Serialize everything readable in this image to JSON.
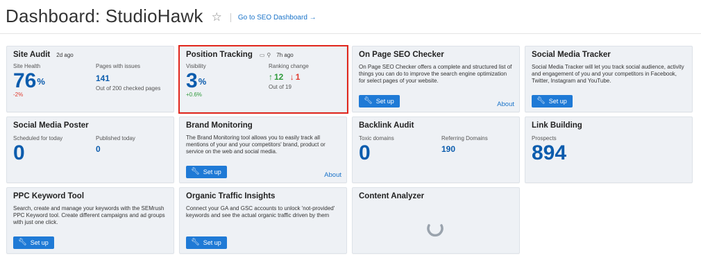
{
  "header": {
    "title": "Dashboard: StudioHawk",
    "seo_link": "Go to SEO Dashboard →"
  },
  "site_audit": {
    "title": "Site Audit",
    "age": "2d ago",
    "health_label": "Site Health",
    "health_value": "76",
    "health_unit": "%",
    "health_change": "-2%",
    "pages_label": "Pages with issues",
    "pages_value": "141",
    "pages_sub": "Out of 200 checked pages"
  },
  "position_tracking": {
    "title": "Position Tracking",
    "age": "7h ago",
    "visibility_label": "Visibility",
    "visibility_value": "3",
    "visibility_unit": "%",
    "visibility_change": "+0.6%",
    "ranking_label": "Ranking change",
    "up_value": "12",
    "down_value": "1",
    "out_of": "Out of 19"
  },
  "on_page": {
    "title": "On Page SEO Checker",
    "desc": "On Page SEO Checker offers a complete and structured list of things you can do to improve the search engine optimization for select pages of your website.",
    "button": "Set up",
    "about": "About"
  },
  "social_tracker": {
    "title": "Social Media Tracker",
    "desc": "Social Media Tracker will let you track social audience, activity and engagement of you and your competitors in Facebook, Twitter, Instagram and YouTube.",
    "button": "Set up"
  },
  "social_poster": {
    "title": "Social Media Poster",
    "scheduled_label": "Scheduled for today",
    "scheduled_value": "0",
    "published_label": "Published today",
    "published_value": "0"
  },
  "brand": {
    "title": "Brand Monitoring",
    "desc": "The Brand Monitoring tool allows you to easily track all mentions of your and your competitors' brand, product or service on the web and social media.",
    "button": "Set up",
    "about": "About"
  },
  "backlink": {
    "title": "Backlink Audit",
    "toxic_label": "Toxic domains",
    "toxic_value": "0",
    "ref_label": "Referring Domains",
    "ref_value": "190"
  },
  "link_building": {
    "title": "Link Building",
    "prospects_label": "Prospects",
    "prospects_value": "894"
  },
  "ppc": {
    "title": "PPC Keyword Tool",
    "desc": "Search, create and manage your keywords with the SEMrush PPC Keyword tool. Create different campaigns and ad groups with just one click.",
    "button": "Set up"
  },
  "organic": {
    "title": "Organic Traffic Insights",
    "desc": "Connect your GA and GSC accounts to unlock 'not-provided' keywords and see the actual organic traffic driven by them",
    "button": "Set up"
  },
  "content": {
    "title": "Content Analyzer"
  },
  "colors": {
    "accent": "#1f7ad6",
    "number_blue": "#0b5cad",
    "highlight_red": "#e1261c",
    "card_bg": "#eef1f5"
  }
}
